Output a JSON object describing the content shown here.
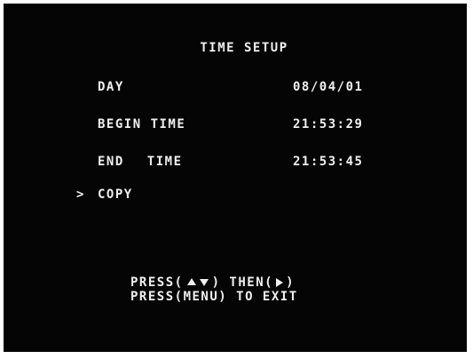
{
  "menu": {
    "title": "TIME SETUP",
    "cursor": ">",
    "day": {
      "label": "DAY",
      "value": "08/04/01"
    },
    "begin_time": {
      "label": "BEGIN TIME",
      "value": "21:53:29"
    },
    "end_time": {
      "label_part1": "END",
      "label_part2": "TIME",
      "value": "21:53:45"
    },
    "copy": {
      "label": "COPY"
    }
  },
  "instructions": {
    "line1_prefix": "PRESS(",
    "line1_middle": ") THEN(",
    "line1_suffix": ")",
    "line2": "PRESS(MENU) TO EXIT",
    "icons": [
      "up-arrow-icon",
      "down-arrow-icon",
      "right-arrow-icon"
    ]
  },
  "colors": {
    "background": "#050505",
    "text": "#f0f0f0"
  }
}
